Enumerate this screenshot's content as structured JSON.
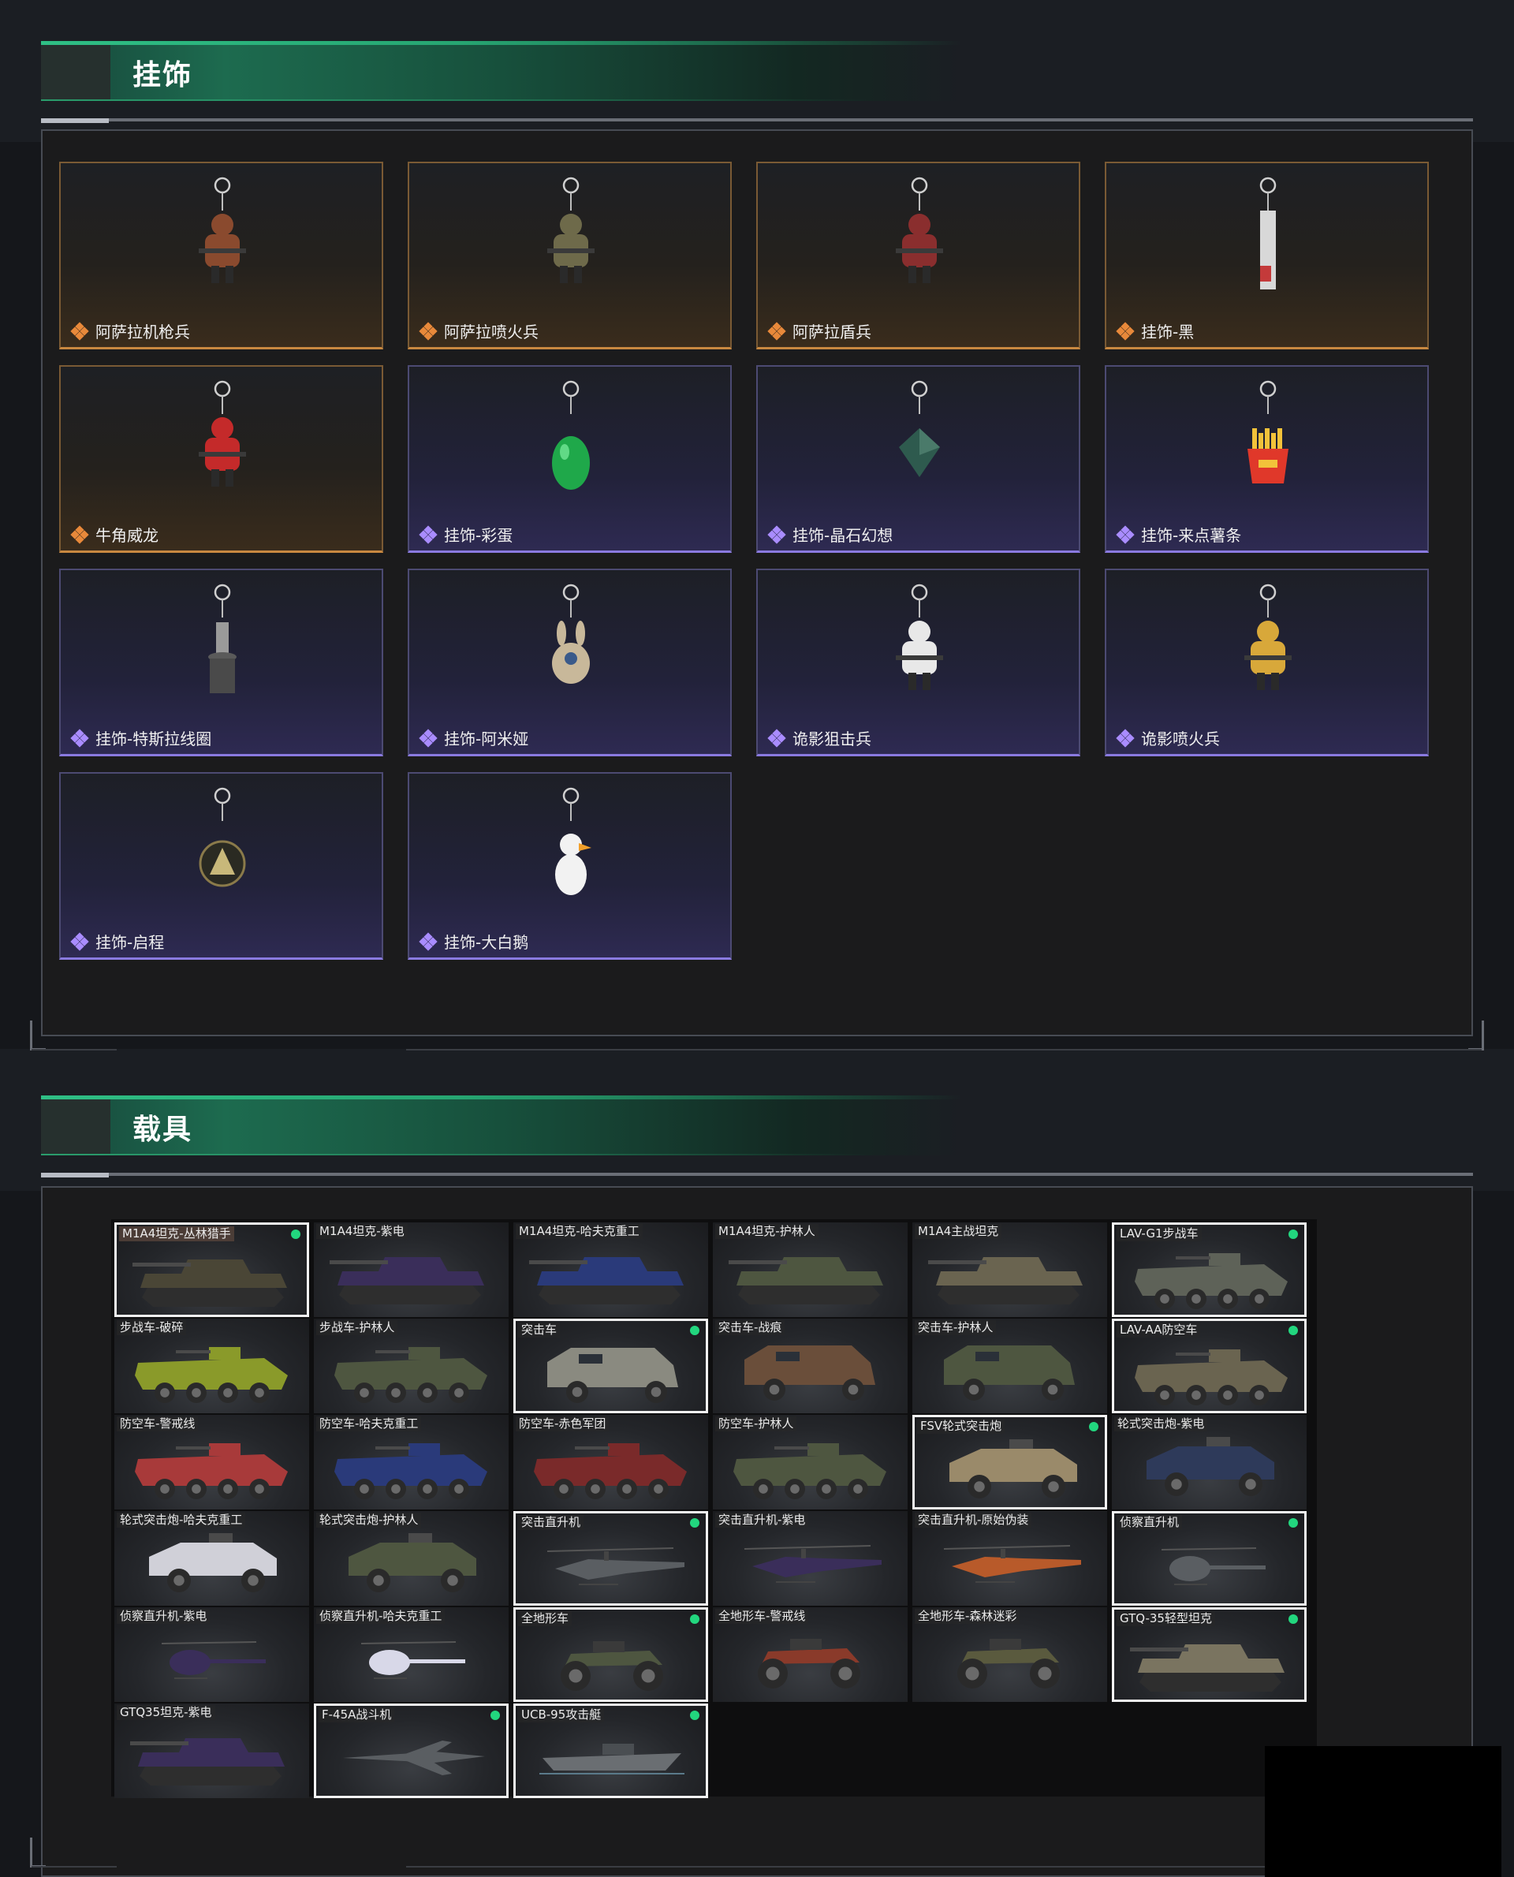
{
  "sections": {
    "charms": {
      "title": "挂饰",
      "items": [
        {
          "name": "阿萨拉机枪兵",
          "rarity": "orange",
          "icon": "soldier-charm-icon",
          "color": "#8a4a2e"
        },
        {
          "name": "阿萨拉喷火兵",
          "rarity": "orange",
          "icon": "soldier-charm-icon",
          "color": "#6e6a4a"
        },
        {
          "name": "阿萨拉盾兵",
          "rarity": "orange",
          "icon": "soldier-charm-icon",
          "color": "#8a2e2e"
        },
        {
          "name": "挂饰-黑",
          "rarity": "orange",
          "icon": "tag-charm-icon",
          "color": "#d8d8d8"
        },
        {
          "name": "牛角威龙",
          "rarity": "orange",
          "icon": "soldier-charm-icon",
          "color": "#c42a2a"
        },
        {
          "name": "挂饰-彩蛋",
          "rarity": "purple",
          "icon": "egg-charm-icon",
          "color": "#1fa84a"
        },
        {
          "name": "挂饰-晶石幻想",
          "rarity": "purple",
          "icon": "crystal-charm-icon",
          "color": "#2e5a4e"
        },
        {
          "name": "挂饰-来点薯条",
          "rarity": "purple",
          "icon": "fries-charm-icon",
          "color": "#e0382a"
        },
        {
          "name": "挂饰-特斯拉线圈",
          "rarity": "purple",
          "icon": "tesla-coil-charm-icon",
          "color": "#6a6a6a"
        },
        {
          "name": "挂饰-阿米娅",
          "rarity": "purple",
          "icon": "bunny-charm-icon",
          "color": "#c8b89a"
        },
        {
          "name": "诡影狙击兵",
          "rarity": "purple",
          "icon": "soldier-charm-icon",
          "color": "#e8e8e8"
        },
        {
          "name": "诡影喷火兵",
          "rarity": "purple",
          "icon": "soldier-charm-icon",
          "color": "#d8a83a"
        },
        {
          "name": "挂饰-启程",
          "rarity": "purple",
          "icon": "emblem-charm-icon",
          "color": "#6a5a3a"
        },
        {
          "name": "挂饰-大白鹅",
          "rarity": "purple",
          "icon": "goose-charm-icon",
          "color": "#f2f2f2"
        }
      ]
    },
    "vehicles": {
      "title": "载具",
      "items": [
        {
          "name": "M1A4坦克-丛林猎手",
          "kind": "tank",
          "owned": true,
          "first": true,
          "color": "#4a4636"
        },
        {
          "name": "M1A4坦克-紫电",
          "kind": "tank",
          "owned": false,
          "color": "#3a2e5a"
        },
        {
          "name": "M1A4坦克-哈夫克重工",
          "kind": "tank",
          "owned": false,
          "color": "#2a3a7a"
        },
        {
          "name": "M1A4坦克-护林人",
          "kind": "tank",
          "owned": false,
          "color": "#4e5640"
        },
        {
          "name": "M1A4主战坦克",
          "kind": "tank",
          "owned": false,
          "color": "#6a6450"
        },
        {
          "name": "LAV-G1步战车",
          "kind": "ifv",
          "owned": true,
          "color": "#5e6258"
        },
        {
          "name": "步战车-破碎",
          "kind": "ifv",
          "owned": false,
          "color": "#8a9a2a"
        },
        {
          "name": "步战车-护林人",
          "kind": "ifv",
          "owned": false,
          "color": "#4e5640"
        },
        {
          "name": "突击车",
          "kind": "armored-car",
          "owned": true,
          "color": "#8a8a80"
        },
        {
          "name": "突击车-战痕",
          "kind": "armored-car",
          "owned": false,
          "color": "#6a4e3a"
        },
        {
          "name": "突击车-护林人",
          "kind": "armored-car",
          "owned": false,
          "color": "#4e5640"
        },
        {
          "name": "LAV-AA防空车",
          "kind": "ifv",
          "owned": true,
          "color": "#6a6450"
        },
        {
          "name": "防空车-警戒线",
          "kind": "ifv",
          "owned": false,
          "color": "#a83a3a"
        },
        {
          "name": "防空车-哈夫克重工",
          "kind": "ifv",
          "owned": false,
          "color": "#2a3a7a"
        },
        {
          "name": "防空车-赤色军团",
          "kind": "ifv",
          "owned": false,
          "color": "#7a2a2a"
        },
        {
          "name": "防空车-护林人",
          "kind": "ifv",
          "owned": false,
          "color": "#4e5640"
        },
        {
          "name": "FSV轮式突击炮",
          "kind": "buggy",
          "owned": true,
          "color": "#9a8a6a"
        },
        {
          "name": "轮式突击炮-紫电",
          "kind": "buggy",
          "owned": false,
          "color": "#2e3a5a"
        },
        {
          "name": "轮式突击炮-哈夫克重工",
          "kind": "buggy",
          "owned": false,
          "color": "#d0d0d8"
        },
        {
          "name": "轮式突击炮-护林人",
          "kind": "buggy",
          "owned": false,
          "color": "#4e5640"
        },
        {
          "name": "突击直升机",
          "kind": "helicopter",
          "owned": true,
          "color": "#5a5e62"
        },
        {
          "name": "突击直升机-紫电",
          "kind": "helicopter",
          "owned": false,
          "color": "#3a2e5a"
        },
        {
          "name": "突击直升机-原始伪装",
          "kind": "helicopter",
          "owned": false,
          "color": "#b85a2a"
        },
        {
          "name": "侦察直升机",
          "kind": "light-heli",
          "owned": true,
          "color": "#5a5e62"
        },
        {
          "name": "侦察直升机-紫电",
          "kind": "light-heli",
          "owned": false,
          "color": "#3a2e5a"
        },
        {
          "name": "侦察直升机-哈夫克重工",
          "kind": "light-heli",
          "owned": false,
          "color": "#d8d8e8"
        },
        {
          "name": "全地形车",
          "kind": "atv",
          "owned": true,
          "color": "#4e5640"
        },
        {
          "name": "全地形车-警戒线",
          "kind": "atv",
          "owned": false,
          "color": "#8a3a2a"
        },
        {
          "name": "全地形车-森林迷彩",
          "kind": "atv",
          "owned": false,
          "color": "#5a5a3e"
        },
        {
          "name": "GTQ-35轻型坦克",
          "kind": "tank",
          "owned": true,
          "color": "#7a7460"
        },
        {
          "name": "GTQ35坦克-紫电",
          "kind": "tank",
          "owned": false,
          "color": "#3a2e5a"
        },
        {
          "name": "F-45A战斗机",
          "kind": "jet",
          "owned": true,
          "color": "#5a5e62"
        },
        {
          "name": "UCB-95攻击艇",
          "kind": "boat",
          "owned": true,
          "color": "#6a6e72"
        }
      ]
    }
  }
}
